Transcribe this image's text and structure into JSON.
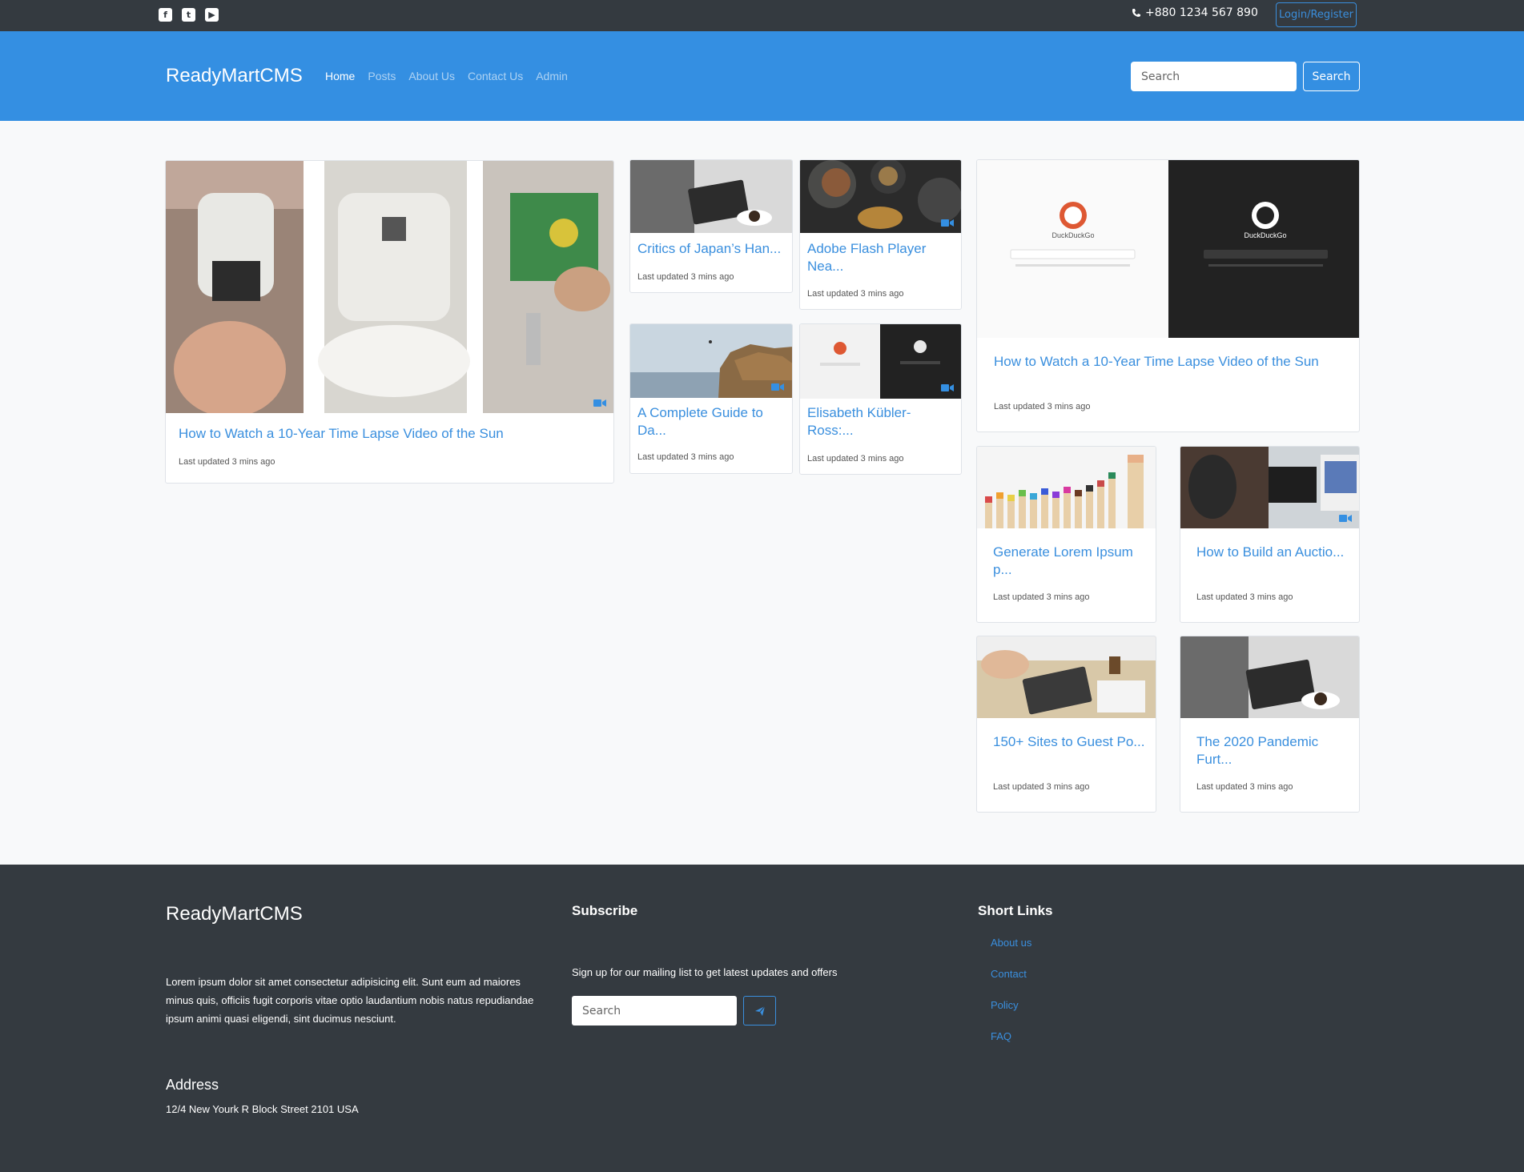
{
  "topbar": {
    "social": [
      {
        "icon": "facebook-icon",
        "glyph": "f"
      },
      {
        "icon": "twitter-icon",
        "glyph": "t"
      },
      {
        "icon": "youtube-icon",
        "glyph": "▶"
      }
    ],
    "phone": "+880 1234 567 890",
    "login_label": "Login/Register"
  },
  "nav": {
    "brand": "ReadyMartCMS",
    "links": [
      "Home",
      "Posts",
      "About Us",
      "Contact Us",
      "Admin"
    ],
    "search_placeholder": "Search",
    "search_button": "Search"
  },
  "posts": [
    {
      "title": "How to Watch a 10-Year Time Lapse Video of the Sun",
      "meta": "Last updated 3 mins ago"
    },
    {
      "title": "Critics of Japan’s Han...",
      "meta": "Last updated 3 mins ago"
    },
    {
      "title": "Adobe Flash Player Nea...",
      "meta": "Last updated 3 mins ago"
    },
    {
      "title": "A Complete Guide to Da...",
      "meta": "Last updated 3 mins ago"
    },
    {
      "title": "Elisabeth Kübler-Ross:...",
      "meta": "Last updated 3 mins ago"
    },
    {
      "title": "How to Watch a 10-Year Time Lapse Video of the Sun",
      "meta": "Last updated 3 mins ago"
    },
    {
      "title": "Generate Lorem Ipsum p...",
      "meta": "Last updated 3 mins ago"
    },
    {
      "title": "How to Build an Auctio...",
      "meta": "Last updated 3 mins ago"
    },
    {
      "title": "150+ Sites to Guest Po...",
      "meta": "Last updated 3 mins ago"
    },
    {
      "title": "The 2020 Pandemic Furt...",
      "meta": "Last updated 3 mins ago"
    }
  ],
  "duckduckgo": {
    "label_light": "DuckDuckGo",
    "label_dark": "DuckDuckGo"
  },
  "footer": {
    "brand": "ReadyMartCMS",
    "about": "Lorem ipsum dolor sit amet consectetur adipisicing elit. Sunt eum ad maiores minus quis, officiis fugit corporis vitae optio laudantium nobis natus repudiandae ipsum animi quasi eligendi, sint ducimus nesciunt.",
    "address_heading": "Address",
    "address": "12/4 New Yourk R Block Street 2101 USA",
    "subscribe_heading": "Subscribe",
    "subscribe_text": "Sign up for our mailing list to get latest updates and offers",
    "subscribe_placeholder": "Search",
    "links_heading": "Short Links",
    "links": [
      "About us",
      "Contact",
      "Policy",
      "FAQ"
    ]
  },
  "colors": {
    "topbar": "#343a40",
    "navbar": "#348fe2",
    "accent": "#3a8fde",
    "footer": "#343a40"
  }
}
